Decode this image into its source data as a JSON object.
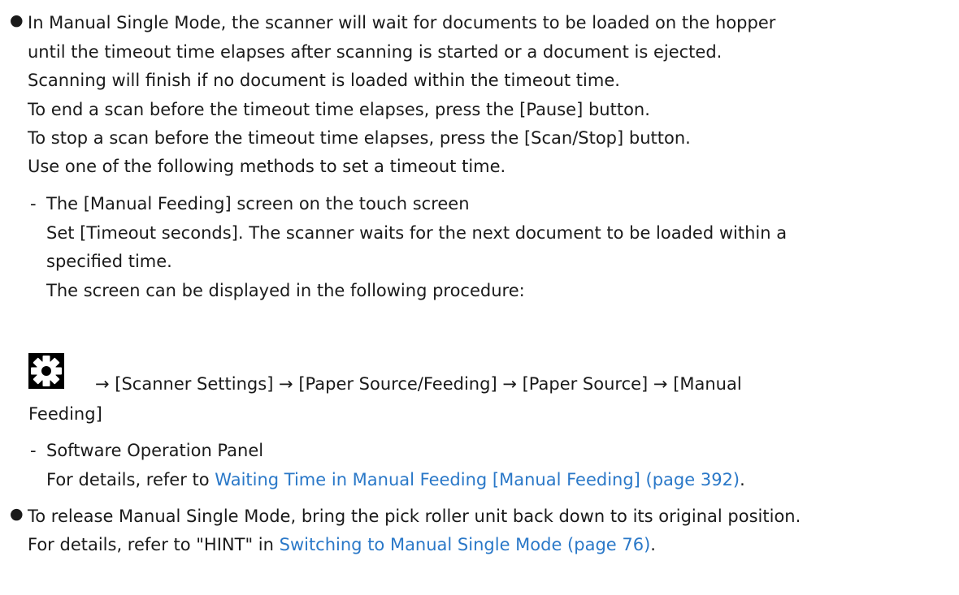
{
  "bullet_char": "●",
  "dash_char": "-",
  "bullet1": {
    "lines": [
      "In Manual Single Mode, the scanner will wait for documents to be loaded on the hopper",
      "until the timeout time elapses after scanning is started or a document is ejected.",
      "Scanning will finish if no document is loaded within the timeout time.",
      "To end a scan before the timeout time elapses, press the [Pause] button.",
      "To stop a scan before the timeout time elapses, press the [Scan/Stop] button.",
      "Use one of the following methods to set a timeout time."
    ]
  },
  "sub1": {
    "title": "The [Manual Feeding] screen on the touch screen",
    "lines": [
      "Set [Timeout seconds]. The scanner waits for the next document to be loaded within a",
      "specified time.",
      "The screen can be displayed in the following procedure:"
    ],
    "procedure_line1": "→ [Scanner Settings] → [Paper Source/Feeding] → [Paper Source] → [Manual",
    "procedure_line2": "Feeding]"
  },
  "sub2": {
    "title": "Software Operation Panel",
    "refer_prefix": "For details, refer to ",
    "link_text": "Waiting Time in Manual Feeding [Manual Feeding] (page 392)",
    "refer_suffix": "."
  },
  "bullet2": {
    "line1": "To release Manual Single Mode, bring the pick roller unit back down to its original position.",
    "refer_prefix": "For details, refer to \"HINT\" in ",
    "link_text": "Switching to Manual Single Mode (page 76)",
    "refer_suffix": "."
  },
  "icons": {
    "settings": "gear-icon"
  }
}
